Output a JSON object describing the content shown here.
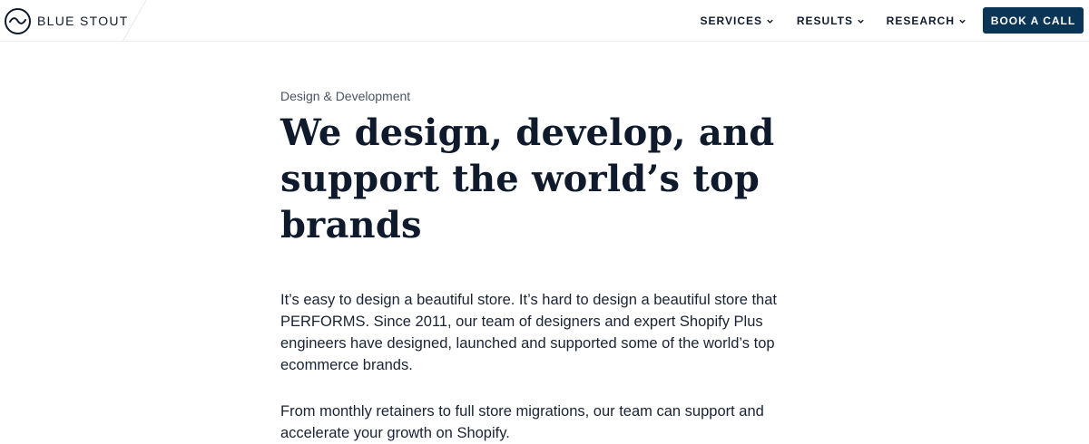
{
  "header": {
    "brand": "BLUE STOUT",
    "nav": [
      {
        "label": "SERVICES"
      },
      {
        "label": "RESULTS"
      },
      {
        "label": "RESEARCH"
      }
    ],
    "cta_label": "BOOK A CALL"
  },
  "hero": {
    "eyebrow": "Design & Development",
    "headline_line1": "We design, develop, and",
    "headline_line2": "support the world’s top brands",
    "paragraph1": "It’s easy to design a beautiful store. It’s hard to design a beautiful store that PERFORMS. Since 2011, our team of designers and expert Shopify Plus engineers have designed, launched and supported some of the world’s top ecommerce brands.",
    "paragraph2": "From monthly retainers to full store migrations, our team can support and accelerate your growth on Shopify."
  },
  "colors": {
    "navy": "#0f1b2d",
    "cta_bg": "#0b3556",
    "muted": "#4a5462"
  }
}
